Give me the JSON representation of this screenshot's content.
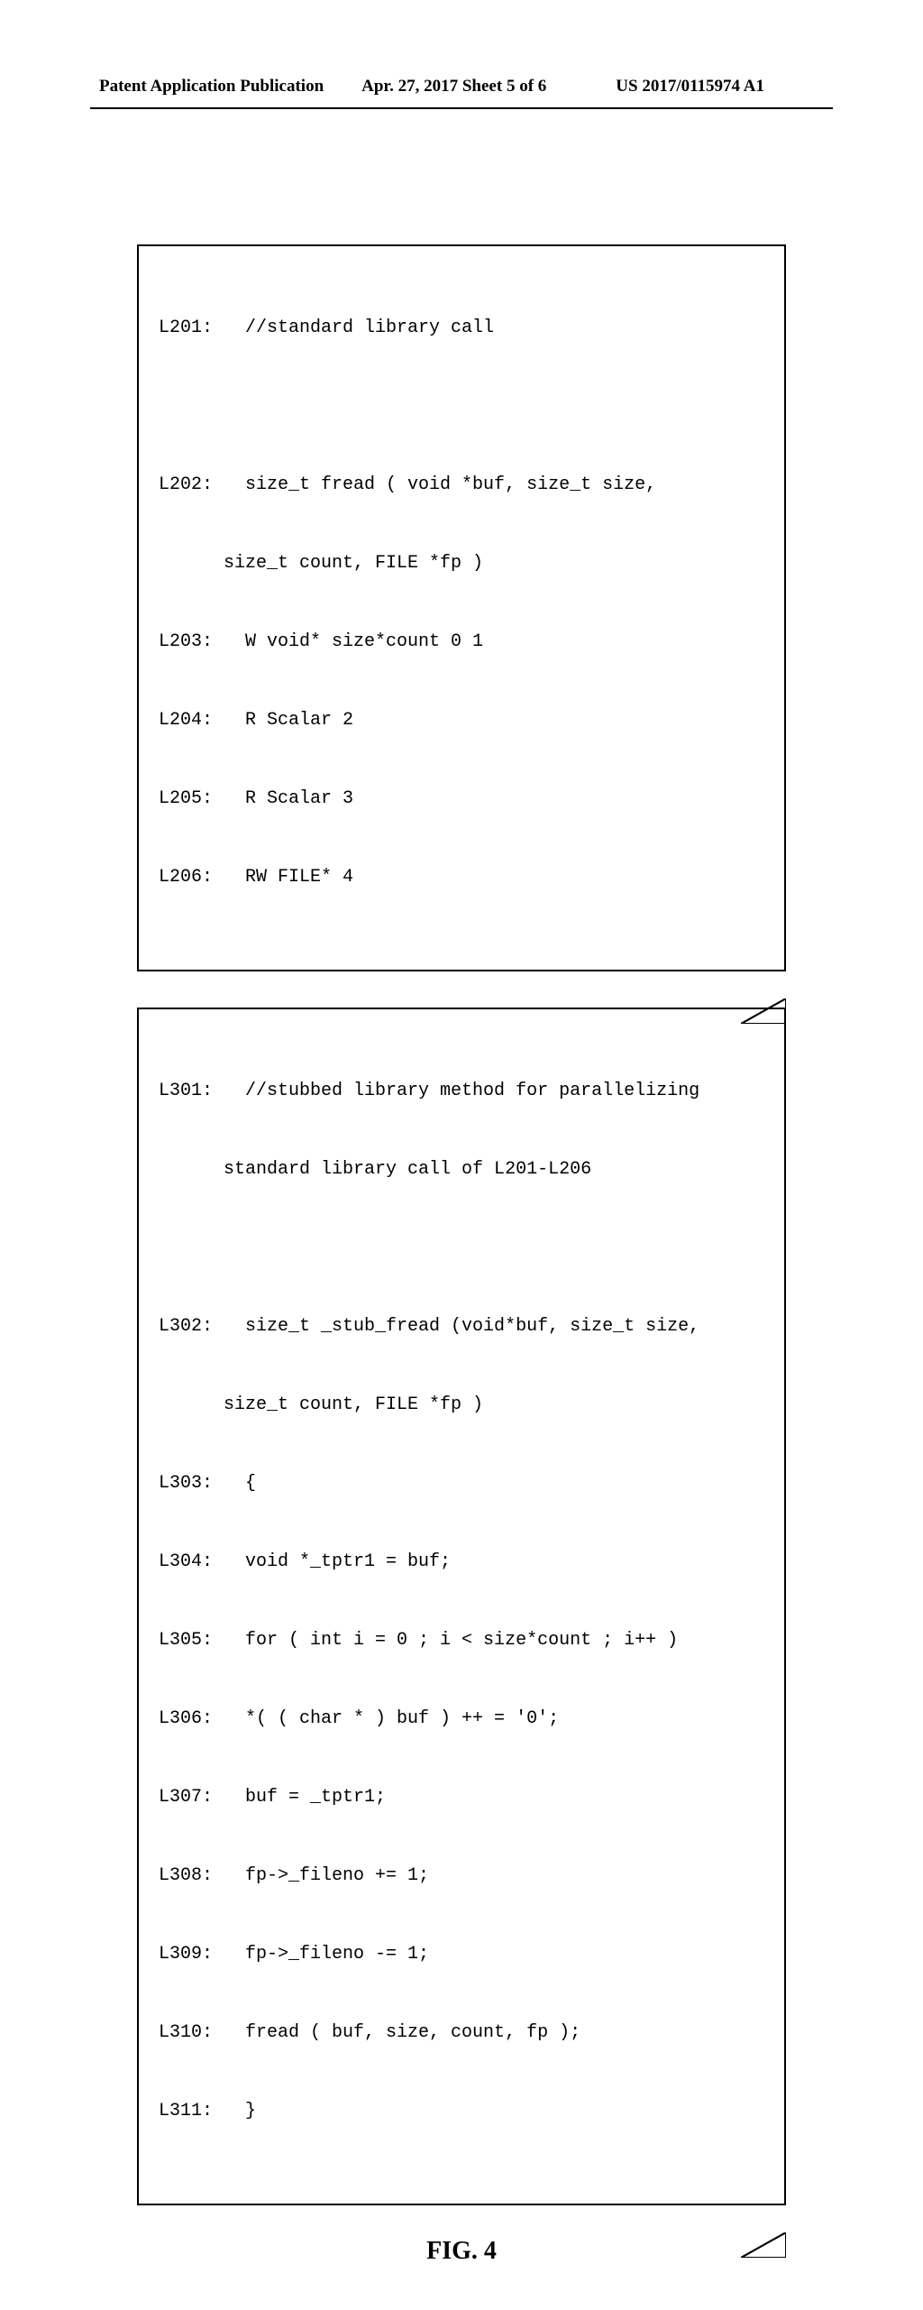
{
  "header": {
    "left": "Patent Application Publication",
    "date": "Apr. 27, 2017  Sheet 5 of 6",
    "right": "US 2017/0115974 A1"
  },
  "box1": {
    "lines": [
      "L201:   //standard library call",
      "",
      "L202:   size_t fread ( void *buf, size_t size,",
      "      size_t count, FILE *fp )",
      "L203:   W void* size*count 0 1",
      "L204:   R Scalar 2",
      "L205:   R Scalar 3",
      "L206:   RW FILE* 4"
    ]
  },
  "box2": {
    "lines": [
      "L301:   //stubbed library method for parallelizing",
      "      standard library call of L201-L206",
      "",
      "L302:   size_t _stub_fread (void*buf, size_t size,",
      "      size_t count, FILE *fp )",
      "L303:   {",
      "L304:   void *_tptr1 = buf;",
      "L305:   for ( int i = 0 ; i < size*count ; i++ )",
      "L306:   *( ( char * ) buf ) ++ = '0';",
      "L307:   buf = _tptr1;",
      "L308:   fp->_fileno += 1;",
      "L309:   fp->_fileno -= 1;",
      "L310:   fread ( buf, size, count, fp );",
      "L311:   }"
    ]
  },
  "figure_label": "FIG. 4"
}
